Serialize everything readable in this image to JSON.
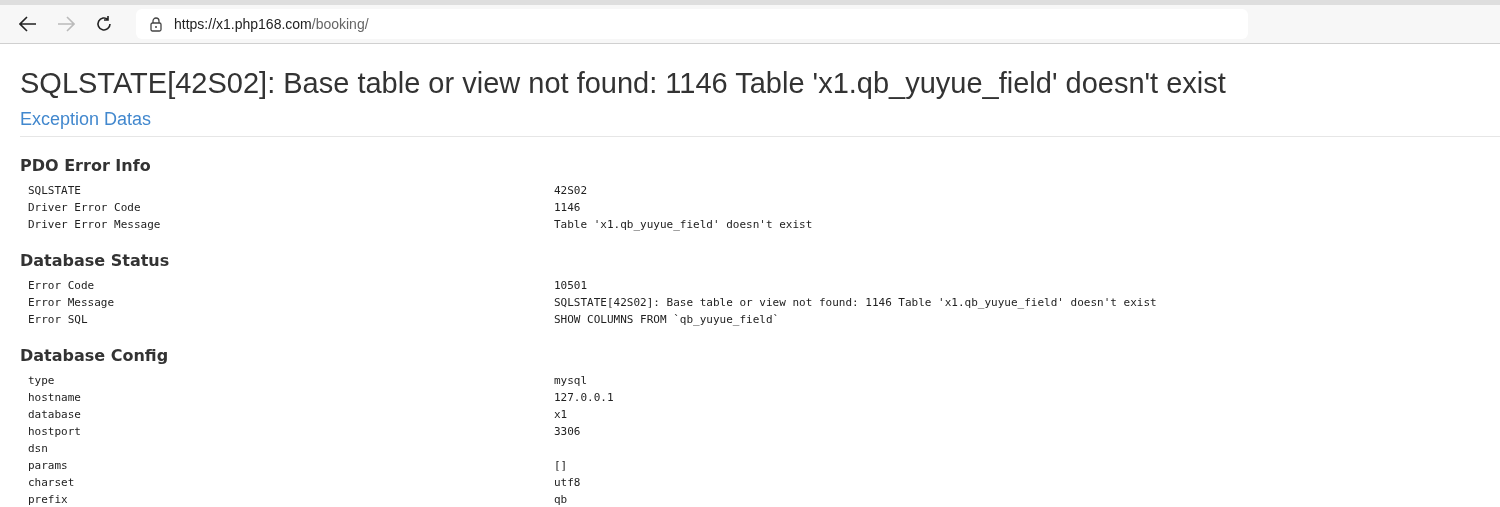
{
  "browser": {
    "url_host": "https://x1.php168.com",
    "url_path": "/booking/",
    "back_disabled": false,
    "forward_disabled": true
  },
  "page": {
    "title": "SQLSTATE[42S02]: Base table or view not found: 1146 Table 'x1.qb_yuyue_field' doesn't exist",
    "link": "Exception Datas"
  },
  "sections": [
    {
      "heading": "PDO Error Info",
      "rows": [
        {
          "key": "SQLSTATE",
          "value": "42S02"
        },
        {
          "key": "Driver Error Code",
          "value": "1146"
        },
        {
          "key": "Driver Error Message",
          "value": "Table 'x1.qb_yuyue_field' doesn't exist"
        }
      ]
    },
    {
      "heading": "Database Status",
      "rows": [
        {
          "key": "Error Code",
          "value": "10501"
        },
        {
          "key": "Error Message",
          "value": "SQLSTATE[42S02]: Base table or view not found: 1146 Table 'x1.qb_yuyue_field' doesn't exist"
        },
        {
          "key": "Error SQL",
          "value": "SHOW COLUMNS FROM `qb_yuyue_field`"
        }
      ]
    },
    {
      "heading": "Database Config",
      "rows": [
        {
          "key": "type",
          "value": "mysql"
        },
        {
          "key": "hostname",
          "value": "127.0.0.1"
        },
        {
          "key": "database",
          "value": "x1"
        },
        {
          "key": "hostport",
          "value": "3306"
        },
        {
          "key": "dsn"
        },
        {
          "key": "params",
          "value": "[]"
        },
        {
          "key": "charset",
          "value": "utf8"
        },
        {
          "key": "prefix",
          "value": "qb"
        }
      ]
    }
  ]
}
